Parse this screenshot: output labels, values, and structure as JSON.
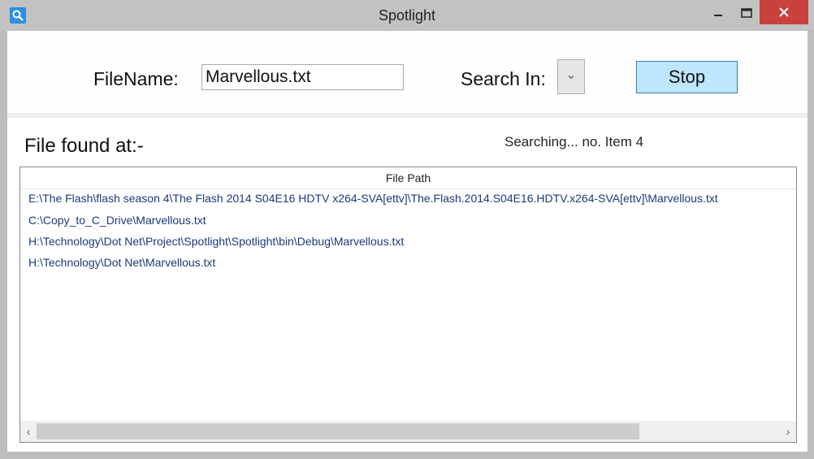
{
  "window": {
    "title": "Spotlight",
    "min_glyph": "—",
    "max_glyph": "☐",
    "close_glyph": "✕",
    "icon": "search-icon"
  },
  "form": {
    "filename_label": "FileName:",
    "filename_value": "Marvellous.txt",
    "search_in_label": "Search In:",
    "search_in_value": "",
    "dropdown_glyph": "˅",
    "stop_label": "Stop"
  },
  "results": {
    "found_label": "File found at:-",
    "status": "Searching... no. Item 4",
    "column_header": "File Path",
    "rows": [
      "E:\\The Flash\\flash season 4\\The Flash 2014 S04E16 HDTV x264-SVA[ettv]\\The.Flash.2014.S04E16.HDTV.x264-SVA[ettv]\\Marvellous.txt",
      "C:\\Copy_to_C_Drive\\Marvellous.txt",
      "H:\\Technology\\Dot Net\\Project\\Spotlight\\Spotlight\\bin\\Debug\\Marvellous.txt",
      "H:\\Technology\\Dot Net\\Marvellous.txt"
    ],
    "scroll_left_glyph": "‹",
    "scroll_right_glyph": "›"
  },
  "colors": {
    "accent": "#bee6fd",
    "close": "#c8413a",
    "link_text": "#1a3a7a"
  }
}
